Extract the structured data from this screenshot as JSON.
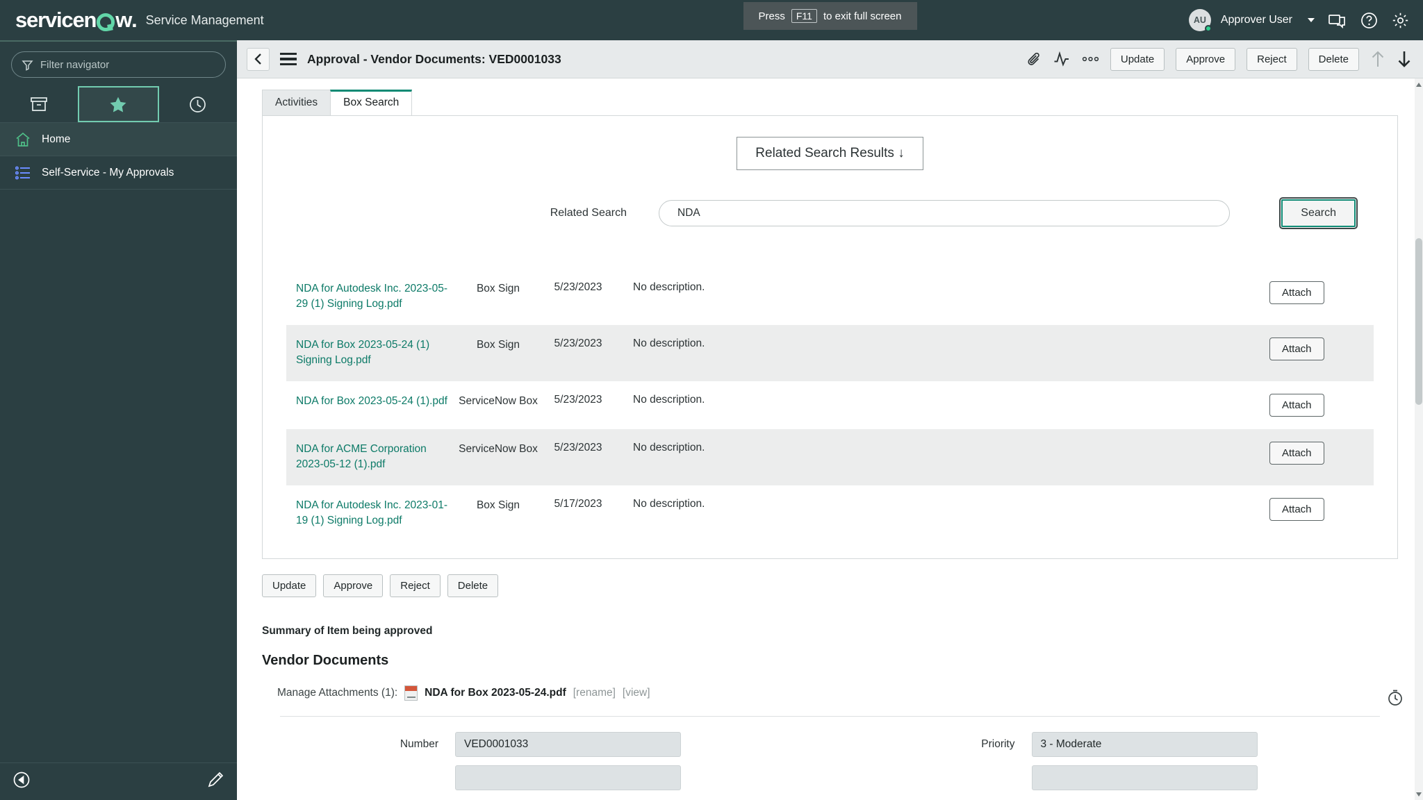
{
  "topbar": {
    "brand": "servicenow",
    "brand_suffix": "Service Management",
    "avatar_initials": "AU",
    "user_name": "Approver User",
    "icons": [
      "chat-icon",
      "help-icon",
      "gear-icon"
    ]
  },
  "fullscreen_toast": {
    "prefix": "Press",
    "key": "F11",
    "suffix": "to exit full screen"
  },
  "sidebar": {
    "filter_placeholder": "Filter navigator",
    "tabs": [
      {
        "name": "all-applications-tab",
        "icon": "archive-box-icon",
        "active": false
      },
      {
        "name": "favorites-tab",
        "icon": "star-icon",
        "active": true
      },
      {
        "name": "history-tab",
        "icon": "clock-icon",
        "active": false
      }
    ],
    "items": [
      {
        "label": "Home",
        "icon": "home-icon"
      },
      {
        "label": "Self-Service - My Approvals",
        "icon": "list-icon"
      }
    ],
    "footer": {
      "collapse_icon": "collapse-left-icon",
      "edit_icon": "pencil-icon"
    }
  },
  "form_header": {
    "back_icon": "chevron-left-icon",
    "menu_icon": "hamburger-menu-icon",
    "title": "Approval - Vendor Documents: VED0001033",
    "icons": [
      {
        "name": "attachment-paperclip-icon"
      },
      {
        "name": "activity-stream-icon"
      },
      {
        "name": "more-options-icon"
      }
    ],
    "buttons": [
      "Update",
      "Approve",
      "Reject",
      "Delete"
    ],
    "nav_up_icon": "arrow-up-icon",
    "nav_down_icon": "arrow-down-icon"
  },
  "tabs": [
    {
      "label": "Activities",
      "active": false
    },
    {
      "label": "Box Search",
      "active": true
    }
  ],
  "box_search": {
    "results_header": "Related Search Results",
    "results_header_arrow": "↓",
    "search_label": "Related Search",
    "search_value": "NDA",
    "search_placeholder": "",
    "search_button": "Search",
    "attach_button": "Attach",
    "rows": [
      {
        "name": "NDA for Autodesk Inc. 2023-05-29 (1) Signing Log.pdf",
        "source": "Box Sign",
        "date": "5/23/2023",
        "description": "No description."
      },
      {
        "name": "NDA for Box 2023-05-24 (1) Signing Log.pdf",
        "source": "Box Sign",
        "date": "5/23/2023",
        "description": "No description."
      },
      {
        "name": "NDA for Box 2023-05-24 (1).pdf",
        "source": "ServiceNow Box",
        "date": "5/23/2023",
        "description": "No description."
      },
      {
        "name": "NDA for ACME Corporation 2023-05-12 (1).pdf",
        "source": "ServiceNow Box",
        "date": "5/23/2023",
        "description": "No description."
      },
      {
        "name": "NDA for Autodesk Inc. 2023-01-19 (1) Signing Log.pdf",
        "source": "Box Sign",
        "date": "5/17/2023",
        "description": "No description."
      }
    ]
  },
  "bottom_buttons": [
    "Update",
    "Approve",
    "Reject",
    "Delete"
  ],
  "summary": {
    "label": "Summary of Item being approved",
    "section_title": "Vendor Documents",
    "attachments_label": "Manage Attachments (1):",
    "attachment_name": "NDA for Box 2023-05-24.pdf",
    "rename_link": "[rename]",
    "view_link": "[view]"
  },
  "form_fields": {
    "left": [
      {
        "label": "Number",
        "value": "VED0001033"
      }
    ],
    "right": [
      {
        "label": "Priority",
        "value": "3 - Moderate"
      }
    ]
  },
  "colors": {
    "brand_dark": "#2b3f42",
    "accent_teal": "#0c8a74",
    "link_teal": "#0c7a67",
    "status_green": "#2ecf8f"
  }
}
